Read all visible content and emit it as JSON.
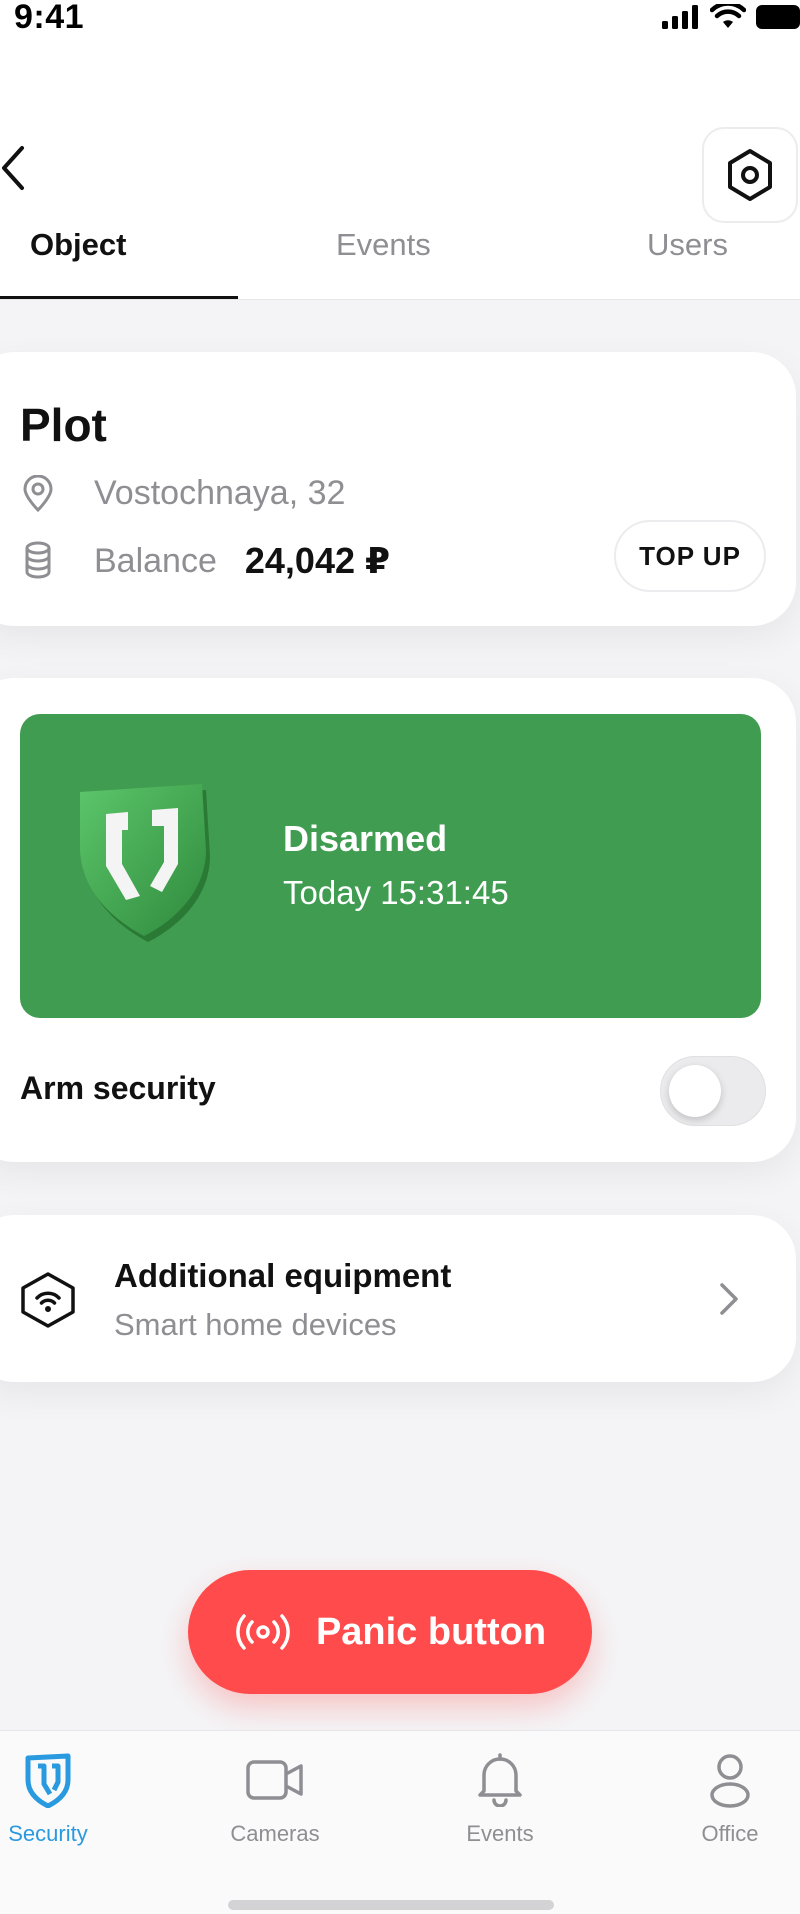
{
  "status_bar": {
    "time": "9:41"
  },
  "tabs": [
    {
      "label": "Object",
      "active": true
    },
    {
      "label": "Events",
      "active": false
    },
    {
      "label": "Users",
      "active": false
    }
  ],
  "object": {
    "title": "Plot",
    "address": "Vostochnaya, 32",
    "balance_label": "Balance",
    "balance_value": "24,042 ₽",
    "top_up_label": "TOP UP"
  },
  "security": {
    "status": "Disarmed",
    "status_time": "Today 15:31:45",
    "arm_label": "Arm security",
    "armed": false
  },
  "equipment": {
    "title": "Additional equipment",
    "subtitle": "Smart home devices"
  },
  "panic_button": {
    "label": "Panic button"
  },
  "bottom_nav": [
    {
      "label": "Security",
      "icon": "shield-icon",
      "active": true
    },
    {
      "label": "Cameras",
      "icon": "camera-icon",
      "active": false
    },
    {
      "label": "Events",
      "icon": "bell-icon",
      "active": false
    },
    {
      "label": "Office",
      "icon": "user-icon",
      "active": false
    }
  ],
  "colors": {
    "status_green": "#409c51",
    "panic_red": "#ff4b4b",
    "accent_blue": "#2a9ae0",
    "muted_text": "#8e8e93"
  }
}
